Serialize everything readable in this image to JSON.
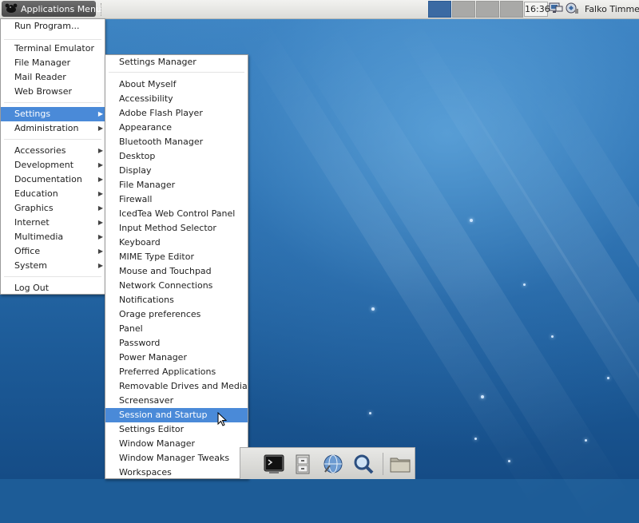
{
  "top_panel": {
    "app_menu_label": "Applications Menu",
    "clock": "16:36",
    "user": "Falko Timme",
    "workspace_count": 4,
    "active_workspace": 1
  },
  "main_menu": {
    "items": [
      {
        "label": "Run Program...",
        "submenu": false
      },
      {
        "label": "Terminal Emulator",
        "submenu": false
      },
      {
        "label": "File Manager",
        "submenu": false
      },
      {
        "label": "Mail Reader",
        "submenu": false
      },
      {
        "label": "Web Browser",
        "submenu": false
      },
      {
        "label": "Settings",
        "submenu": true,
        "selected": true
      },
      {
        "label": "Administration",
        "submenu": true
      },
      {
        "label": "Accessories",
        "submenu": true
      },
      {
        "label": "Development",
        "submenu": true
      },
      {
        "label": "Documentation",
        "submenu": true
      },
      {
        "label": "Education",
        "submenu": true
      },
      {
        "label": "Graphics",
        "submenu": true
      },
      {
        "label": "Internet",
        "submenu": true
      },
      {
        "label": "Multimedia",
        "submenu": true
      },
      {
        "label": "Office",
        "submenu": true
      },
      {
        "label": "System",
        "submenu": true
      },
      {
        "label": "Log Out",
        "submenu": false
      }
    ]
  },
  "settings_menu": {
    "items": [
      {
        "label": "Settings Manager"
      },
      {
        "label": "About Myself"
      },
      {
        "label": "Accessibility"
      },
      {
        "label": "Adobe Flash Player"
      },
      {
        "label": "Appearance"
      },
      {
        "label": "Bluetooth Manager"
      },
      {
        "label": "Desktop"
      },
      {
        "label": "Display"
      },
      {
        "label": "File Manager"
      },
      {
        "label": "Firewall"
      },
      {
        "label": "IcedTea Web Control Panel"
      },
      {
        "label": "Input Method Selector"
      },
      {
        "label": "Keyboard"
      },
      {
        "label": "MIME Type Editor"
      },
      {
        "label": "Mouse and Touchpad"
      },
      {
        "label": "Network Connections"
      },
      {
        "label": "Notifications"
      },
      {
        "label": "Orage preferences"
      },
      {
        "label": "Panel"
      },
      {
        "label": "Password"
      },
      {
        "label": "Power Manager"
      },
      {
        "label": "Preferred Applications"
      },
      {
        "label": "Removable Drives and Media"
      },
      {
        "label": "Screensaver"
      },
      {
        "label": "Session and Startup",
        "selected": true
      },
      {
        "label": "Settings Editor"
      },
      {
        "label": "Window Manager"
      },
      {
        "label": "Window Manager Tweaks"
      },
      {
        "label": "Workspaces"
      }
    ]
  },
  "dock": {
    "icons": [
      "terminal-icon",
      "file-cabinet-icon",
      "web-browser-icon",
      "search-icon",
      "folder-icon"
    ]
  },
  "colors": {
    "selection": "#4a8ad8",
    "desktop": "#2a6fae",
    "active_workspace": "#3b6aa3"
  }
}
